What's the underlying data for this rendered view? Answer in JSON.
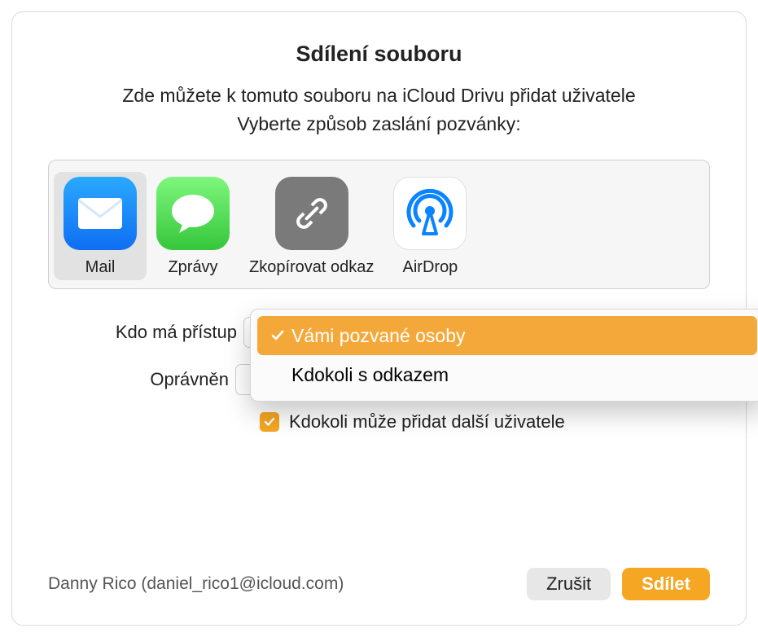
{
  "title": "Sdílení souboru",
  "subtitle": "Zde můžete k tomuto souboru na iCloud Drivu přidat uživatele",
  "instruction": "Vyberte způsob zaslání pozvánky:",
  "methods": [
    {
      "label": "Mail",
      "icon": "mail-icon",
      "selected": true
    },
    {
      "label": "Zprávy",
      "icon": "messages-icon",
      "selected": false
    },
    {
      "label": "Zkopírovat odkaz",
      "icon": "link-icon",
      "selected": false
    },
    {
      "label": "AirDrop",
      "icon": "airdrop-icon",
      "selected": false
    }
  ],
  "access": {
    "label": "Kdo má přístup",
    "selected": "Vámi pozvané osoby",
    "options": [
      "Vámi pozvané osoby",
      "Kdokoli s odkazem"
    ]
  },
  "permission": {
    "label": "Oprávněn"
  },
  "allow_add": {
    "checked": true,
    "label": "Kdokoli může přidat další uživatele"
  },
  "user_line": "Danny Rico (daniel_rico1@icloud.com)",
  "buttons": {
    "cancel": "Zrušit",
    "share": "Sdílet"
  },
  "colors": {
    "accent": "#f5a623"
  }
}
